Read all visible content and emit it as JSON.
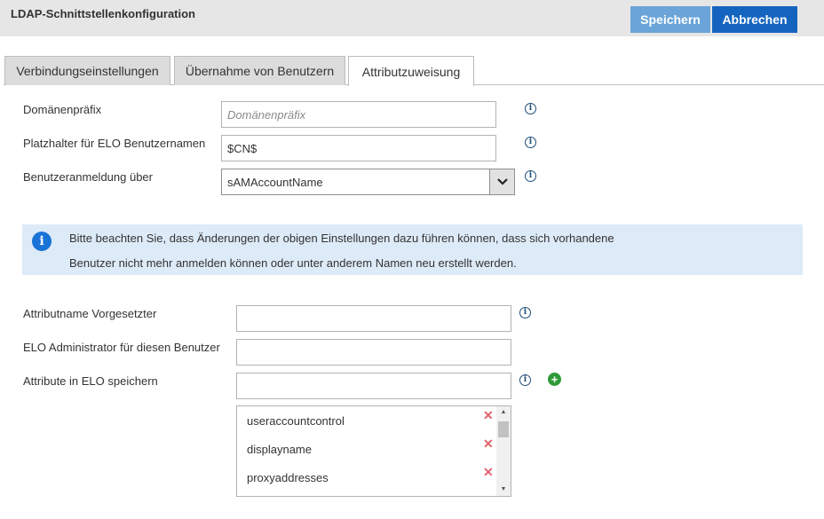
{
  "header": {
    "title": "LDAP-Schnittstellenkonfiguration",
    "save_label": "Speichern",
    "cancel_label": "Abbrechen"
  },
  "tabs": [
    {
      "label": "Verbindungseinstellungen",
      "active": false
    },
    {
      "label": "Übernahme von Benutzern",
      "active": false
    },
    {
      "label": "Attributzuweisung",
      "active": true
    }
  ],
  "fields": {
    "domain_prefix": {
      "label": "Domänenpräfix",
      "value": "",
      "placeholder": "Domänenpräfix"
    },
    "placeholder_username": {
      "label": "Platzhalter für ELO Benutzernamen",
      "value": "$CN$"
    },
    "login_via": {
      "label": "Benutzeranmeldung über",
      "selected": "sAMAccountName"
    },
    "supervisor_attr": {
      "label": "Attributname Vorgesetzter",
      "value": ""
    },
    "elo_admin": {
      "label": "ELO Administrator für diesen Benutzer",
      "value": ""
    },
    "store_attrs": {
      "label": "Attribute in ELO speichern",
      "value": ""
    }
  },
  "notice": {
    "line1": "Bitte beachten Sie, dass Änderungen der obigen Einstellungen dazu führen können, dass sich vorhandene",
    "line2": "Benutzer nicht mehr anmelden können oder unter anderem Namen neu erstellt werden."
  },
  "attribute_list": [
    "useraccountcontrol",
    "displayname",
    "proxyaddresses"
  ],
  "icons": {
    "info": "info-icon",
    "add": "add-icon",
    "remove": "remove-icon",
    "dropdown": "chevron-down-icon"
  },
  "colors": {
    "save_button": "#6aa4d8",
    "cancel_button": "#1565c0",
    "notice_bg": "#ddeaf8",
    "add_icon": "#2e9a38",
    "remove_icon": "#e0626a"
  }
}
